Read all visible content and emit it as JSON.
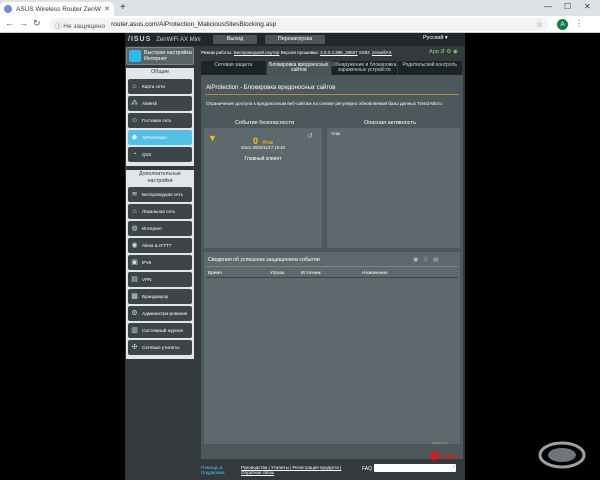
{
  "browser": {
    "tab_title": "ASUS Wireless Router ZenWiFi A",
    "new_tab": "+",
    "window_controls": [
      "—",
      "☐",
      "✕"
    ],
    "security_label": "ⓘ Не защищено",
    "url": "router.asus.com/AiProtection_MaliciousSitesBlocking.asp",
    "avatar_letter": "A"
  },
  "router_header": {
    "brand": "/ISUS",
    "model": "ZenWiFi AX Mini",
    "logout_button": "Выход",
    "reboot_button": "Перезагрузка",
    "language": "Русский ▾"
  },
  "status_bar": {
    "mode_label": "Режим работы:",
    "mode_value": "Беспроводной роутер",
    "firmware_label": "Версия прошивки:",
    "firmware_value": "3.0.0.4.386_39507",
    "ssid_label": "SSID:",
    "ssid_value": "zenwifiAX",
    "app_label": "App"
  },
  "sidebar": {
    "quick_setup": "Быстрая настройка Интернет",
    "general_header": "Общие",
    "general_items": [
      {
        "label": "Карта сети",
        "icon": "network-map-icon",
        "glyph": "⌂"
      },
      {
        "label": "AiMesh",
        "icon": "aimesh-icon",
        "glyph": "⁂"
      },
      {
        "label": "Гостевая сеть",
        "icon": "guest-network-icon",
        "glyph": "☺"
      },
      {
        "label": "AiProtection",
        "icon": "shield-icon",
        "glyph": "◆",
        "active": true
      },
      {
        "label": "QoS",
        "icon": "qos-icon",
        "glyph": "◔"
      }
    ],
    "advanced_header": "Дополнительные настройки",
    "advanced_items": [
      {
        "label": "Беспроводная сеть",
        "icon": "wireless-icon",
        "glyph": "≋"
      },
      {
        "label": "Локальная сеть",
        "icon": "lan-icon",
        "glyph": "⌂"
      },
      {
        "label": "Интернет",
        "icon": "globe-icon",
        "glyph": "◍"
      },
      {
        "label": "Alexa & IFTTT",
        "icon": "alexa-icon",
        "glyph": "◉"
      },
      {
        "label": "IPv6",
        "icon": "ipv6-icon",
        "glyph": "▣"
      },
      {
        "label": "VPN",
        "icon": "vpn-icon",
        "glyph": "▤"
      },
      {
        "label": "Брандмауэр",
        "icon": "firewall-icon",
        "glyph": "▦"
      },
      {
        "label": "Администри-рование",
        "icon": "admin-icon",
        "glyph": "⚙"
      },
      {
        "label": "Системный журнал",
        "icon": "log-icon",
        "glyph": "▥"
      },
      {
        "label": "Сетевые утилиты",
        "icon": "tools-icon",
        "glyph": "✣"
      }
    ]
  },
  "tabs": [
    {
      "label": "Сетевая защита",
      "active": false
    },
    {
      "label": "Блокировка вредоносных сайтов",
      "active": true
    },
    {
      "label": "Обнаружение и блокировка зараженных устройств",
      "active": false
    },
    {
      "label": "Родительский контроль",
      "active": false
    }
  ],
  "main": {
    "title": "AiProtection - Блокировка вредоносных сайтов",
    "description": "Ограничение доступа к вредоносным веб-сайтам на основе регулярно обновляемой базы данных Trend Micro.",
    "security_event_header": "Событие безопасности",
    "threat_activity_header": "Опасная активность",
    "attack_count": "0",
    "attack_unit": "Атак",
    "since": "Since 2020/11/17 15:40",
    "client": "Главный клиент",
    "activity_label": "Атак",
    "details_title": "Сведения об успешном защищенном событии",
    "table_headers": [
      "Время",
      "Угроза",
      "Источник",
      "Назначение"
    ]
  },
  "branding": {
    "powered_by": "Powered by",
    "trend_name": "TREND",
    "trend_sub": "MICRO"
  },
  "footer": {
    "help": "Помощь & Поддержка",
    "links": "Руководства | Утилиты | Регистрация продукта | Обратная связь",
    "faq": "FAQ"
  }
}
